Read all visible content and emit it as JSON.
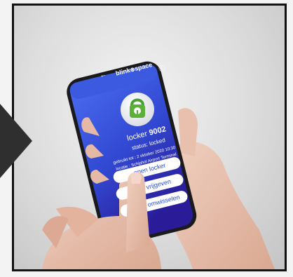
{
  "app": {
    "brand": "blink",
    "brand_symbol": "⊗",
    "brand_suffix": "space"
  },
  "locker": {
    "prefix": "locker",
    "number": "9002",
    "status": "status: locked",
    "detail_line1": "gebruikt tot : 2 oktober 2020 10:30",
    "detail_line2": "locatie : Schiphol Airport Terminal"
  },
  "buttons": {
    "open": "open locker",
    "release": "vrijgeven",
    "swap": "omwisselen"
  },
  "icons": {
    "back": "arrow-left-icon",
    "info": "info-icon",
    "lock": "padlock-icon"
  },
  "colors": {
    "accent": "#2b4fd6",
    "screen_top": "#3e5ee0",
    "screen_bottom": "#2a1d9c",
    "lock_green": "#5bb036"
  }
}
